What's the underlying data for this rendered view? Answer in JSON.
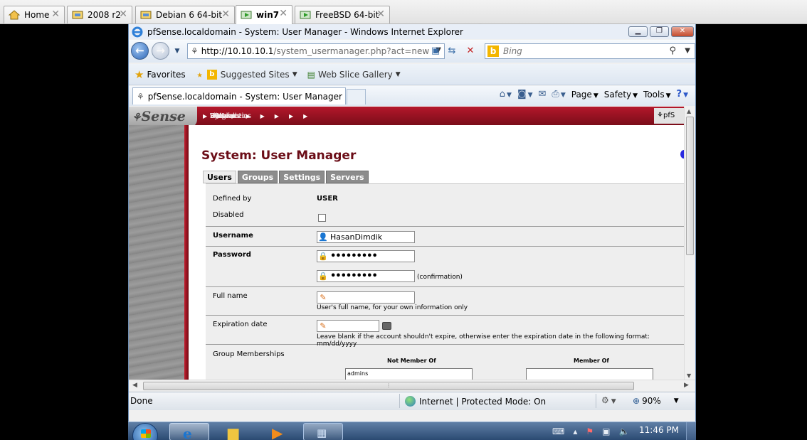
{
  "host_tabs": [
    {
      "label": "Home",
      "icon": "home-icon",
      "active": false
    },
    {
      "label": "2008 r2",
      "icon": "vm-icon",
      "active": false
    },
    {
      "label": "Debian 6 64-bit",
      "icon": "vm-icon",
      "active": false
    },
    {
      "label": "win7",
      "icon": "vm-running-icon",
      "active": true
    },
    {
      "label": "FreeBSD 64-bit",
      "icon": "vm-running-icon",
      "active": false
    }
  ],
  "ie": {
    "window_title": "pfSense.localdomain - System: User Manager - Windows Internet Explorer",
    "address_host": "http://10.10.10.1",
    "address_path": "/system_usermanager.php?act=new",
    "search_placeholder": "Bing",
    "favorites_label": "Favorites",
    "suggested_sites": "Suggested Sites",
    "web_slice_gallery": "Web Slice Gallery",
    "tab_title": "pfSense.localdomain - System: User Manager",
    "cmd_page": "Page",
    "cmd_safety": "Safety",
    "cmd_tools": "Tools",
    "status_done": "Done",
    "status_zone": "Internet | Protected Mode: On",
    "zoom": "90%"
  },
  "pfsense": {
    "logo": "Sense",
    "menu": [
      "System",
      "Interfaces",
      "Firewall",
      "Services",
      "VPN",
      "Status",
      "Diagnostics",
      "Help"
    ],
    "right_text": "pfS",
    "page_title": "System: User Manager",
    "tabs": [
      "Users",
      "Groups",
      "Settings",
      "Servers"
    ],
    "form": {
      "defined_by_label": "Defined by",
      "defined_by_value": "USER",
      "disabled_label": "Disabled",
      "username_label": "Username",
      "username_value": "HasanDimdik",
      "password_label": "Password",
      "password_mask": "•••••••••",
      "password_confirm_mask": "•••••••••",
      "confirmation_label": "(confirmation)",
      "fullname_label": "Full name",
      "fullname_help": "User's full name, for your own information only",
      "expiration_label": "Expiration date",
      "expiration_help": "Leave blank if the account shouldn't expire, otherwise enter the expiration date in the following format: mm/dd/yyyy",
      "group_memberships_label": "Group Memberships",
      "not_member_of": "Not Member Of",
      "member_of": "Member Of",
      "not_member_groups": [
        "admins"
      ]
    }
  },
  "taskbar": {
    "clock": "11:46 PM"
  }
}
